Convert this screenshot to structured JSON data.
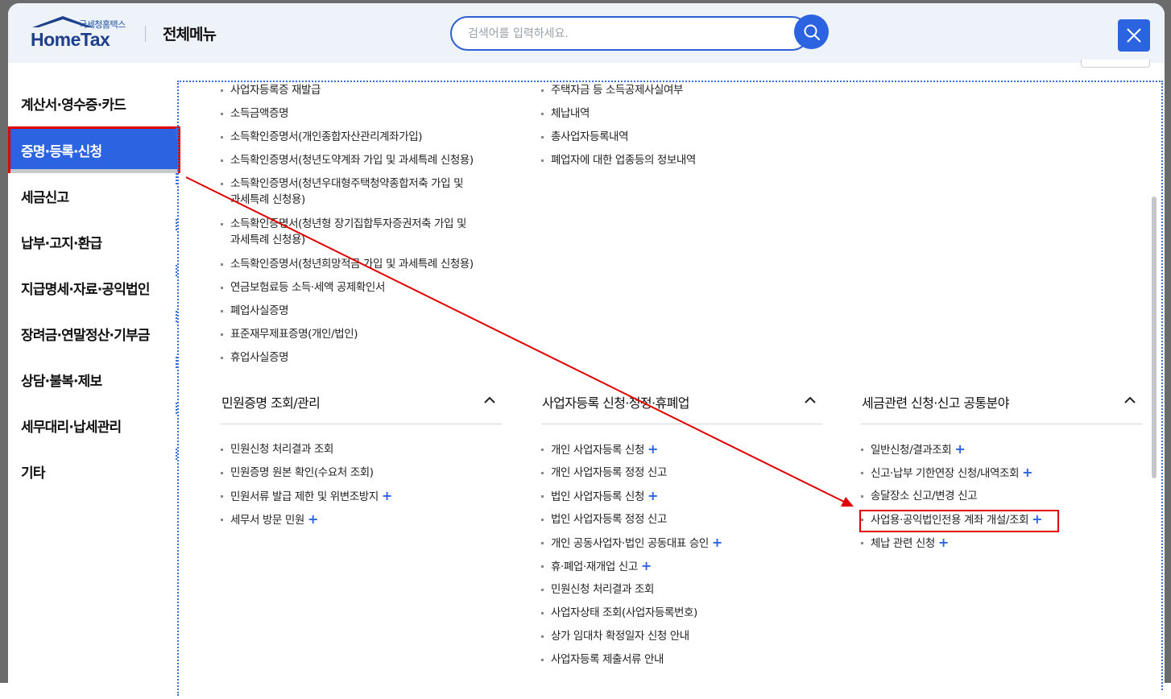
{
  "header": {
    "logo_small": "국세청홈택스",
    "logo_main": "HomeTax",
    "title": "전체메뉴",
    "search_placeholder": "검색어를 입력하세요."
  },
  "sidebar": {
    "items": [
      {
        "label": "계산서·영수증·카드"
      },
      {
        "label": "증명·등록·신청",
        "active": true
      },
      {
        "label": "세금신고"
      },
      {
        "label": "납부·고지·환급"
      },
      {
        "label": "지급명세·자료·공익법인"
      },
      {
        "label": "장려금·연말정산·기부금"
      },
      {
        "label": "상담·불복·제보"
      },
      {
        "label": "세무대리·납세관리"
      },
      {
        "label": "기타"
      }
    ]
  },
  "top_left_list": [
    {
      "label": "사업자등록증 재발급"
    },
    {
      "label": "소득금액증명"
    },
    {
      "label": "소득확인증명서(개인종합자산관리계좌가입)"
    },
    {
      "label": "소득확인증명서(청년도약계좌 가입 및 과세특례 신청용)"
    },
    {
      "label": "소득확인증명서(청년우대형주택청약종합저축 가입 및",
      "label2": "과세특례 신청용)"
    },
    {
      "label": "소득확인증명서(청년형 장기집합투자증권저축 가입 및",
      "label2": "과세특례 신청용)"
    },
    {
      "label": "소득확인증명서(청년희망적금 가입 및 과세특례 신청용)"
    },
    {
      "label": "연금보험료등 소득·세액 공제확인서"
    },
    {
      "label": "폐업사실증명"
    },
    {
      "label": "표준재무제표증명(개인/법인)"
    },
    {
      "label": "휴업사실증명"
    }
  ],
  "top_mid_list": [
    {
      "label": "주택자금 등 소득공제사실여부"
    },
    {
      "label": "체납내역"
    },
    {
      "label": "총사업자등록내역"
    },
    {
      "label": "폐업자에 대한 업종등의 정보내역"
    }
  ],
  "sections": [
    {
      "title": "민원증명 조회/관리",
      "items": [
        {
          "label": "민원신청 처리결과 조회",
          "plus": false
        },
        {
          "label": "민원증명 원본 확인(수요처 조회)",
          "plus": false
        },
        {
          "label": "민원서류 발급 제한 및 위변조방지",
          "plus": true
        },
        {
          "label": "세무서 방문 민원",
          "plus": true
        }
      ]
    },
    {
      "title": "사업자등록 신청·정정·휴폐업",
      "items": [
        {
          "label": "개인 사업자등록 신청",
          "plus": true
        },
        {
          "label": "개인 사업자등록 정정 신고",
          "plus": false
        },
        {
          "label": "법인 사업자등록 신청",
          "plus": true
        },
        {
          "label": "법인 사업자등록 정정 신고",
          "plus": false
        },
        {
          "label": "개인 공동사업자·법인 공동대표 승인",
          "plus": true
        },
        {
          "label": "휴·폐업·재개업 신고",
          "plus": true
        },
        {
          "label": "민원신청 처리결과 조회",
          "plus": false
        },
        {
          "label": "사업자상태 조회(사업자등록번호)",
          "plus": false
        },
        {
          "label": "상가 임대차 확정일자 신청 안내",
          "plus": false
        },
        {
          "label": "사업자등록 제출서류 안내",
          "plus": false
        }
      ]
    },
    {
      "title": "세금관련 신청·신고 공통분야",
      "items": [
        {
          "label": "일반신청/결과조회",
          "plus": true
        },
        {
          "label": "신고·납부 기한연장 신청/내역조회",
          "plus": true
        },
        {
          "label": "송달장소 신고/변경 신고",
          "plus": false
        },
        {
          "label": "사업용·공익법인전용 계좌 개설/조회",
          "plus": true,
          "highlight": true
        },
        {
          "label": "체납 관련 신청",
          "plus": true
        }
      ]
    }
  ],
  "plus_symbol": "+",
  "colors": {
    "accent": "#2c63e0",
    "highlight": "#e00000",
    "header_bg": "#eef2f9"
  }
}
